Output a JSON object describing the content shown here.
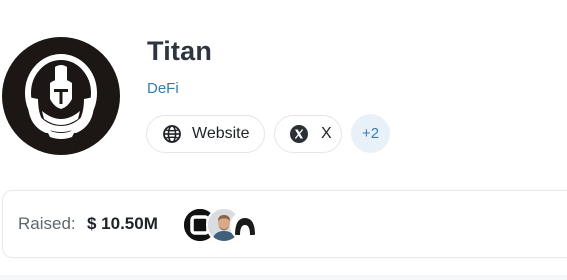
{
  "project": {
    "name": "Titan",
    "category": "DeFi",
    "logo_icon": "spartan-helmet-logo-icon"
  },
  "links": {
    "website_label": "Website",
    "website_icon": "globe-icon",
    "x_label": "X",
    "x_icon": "x-logo-icon",
    "more_label": "+2"
  },
  "funding": {
    "label": "Raised:",
    "value": "$ 10.50M",
    "investors": [
      {
        "icon": "investor-logo-black-icon"
      },
      {
        "icon": "investor-avatar-person-icon"
      },
      {
        "icon": "investor-logo-dark-icon"
      }
    ]
  },
  "colors": {
    "title": "#2e3440",
    "category": "#2f7fb0",
    "more_bg": "#e8f1f8",
    "logo_bg": "#1c1714"
  }
}
